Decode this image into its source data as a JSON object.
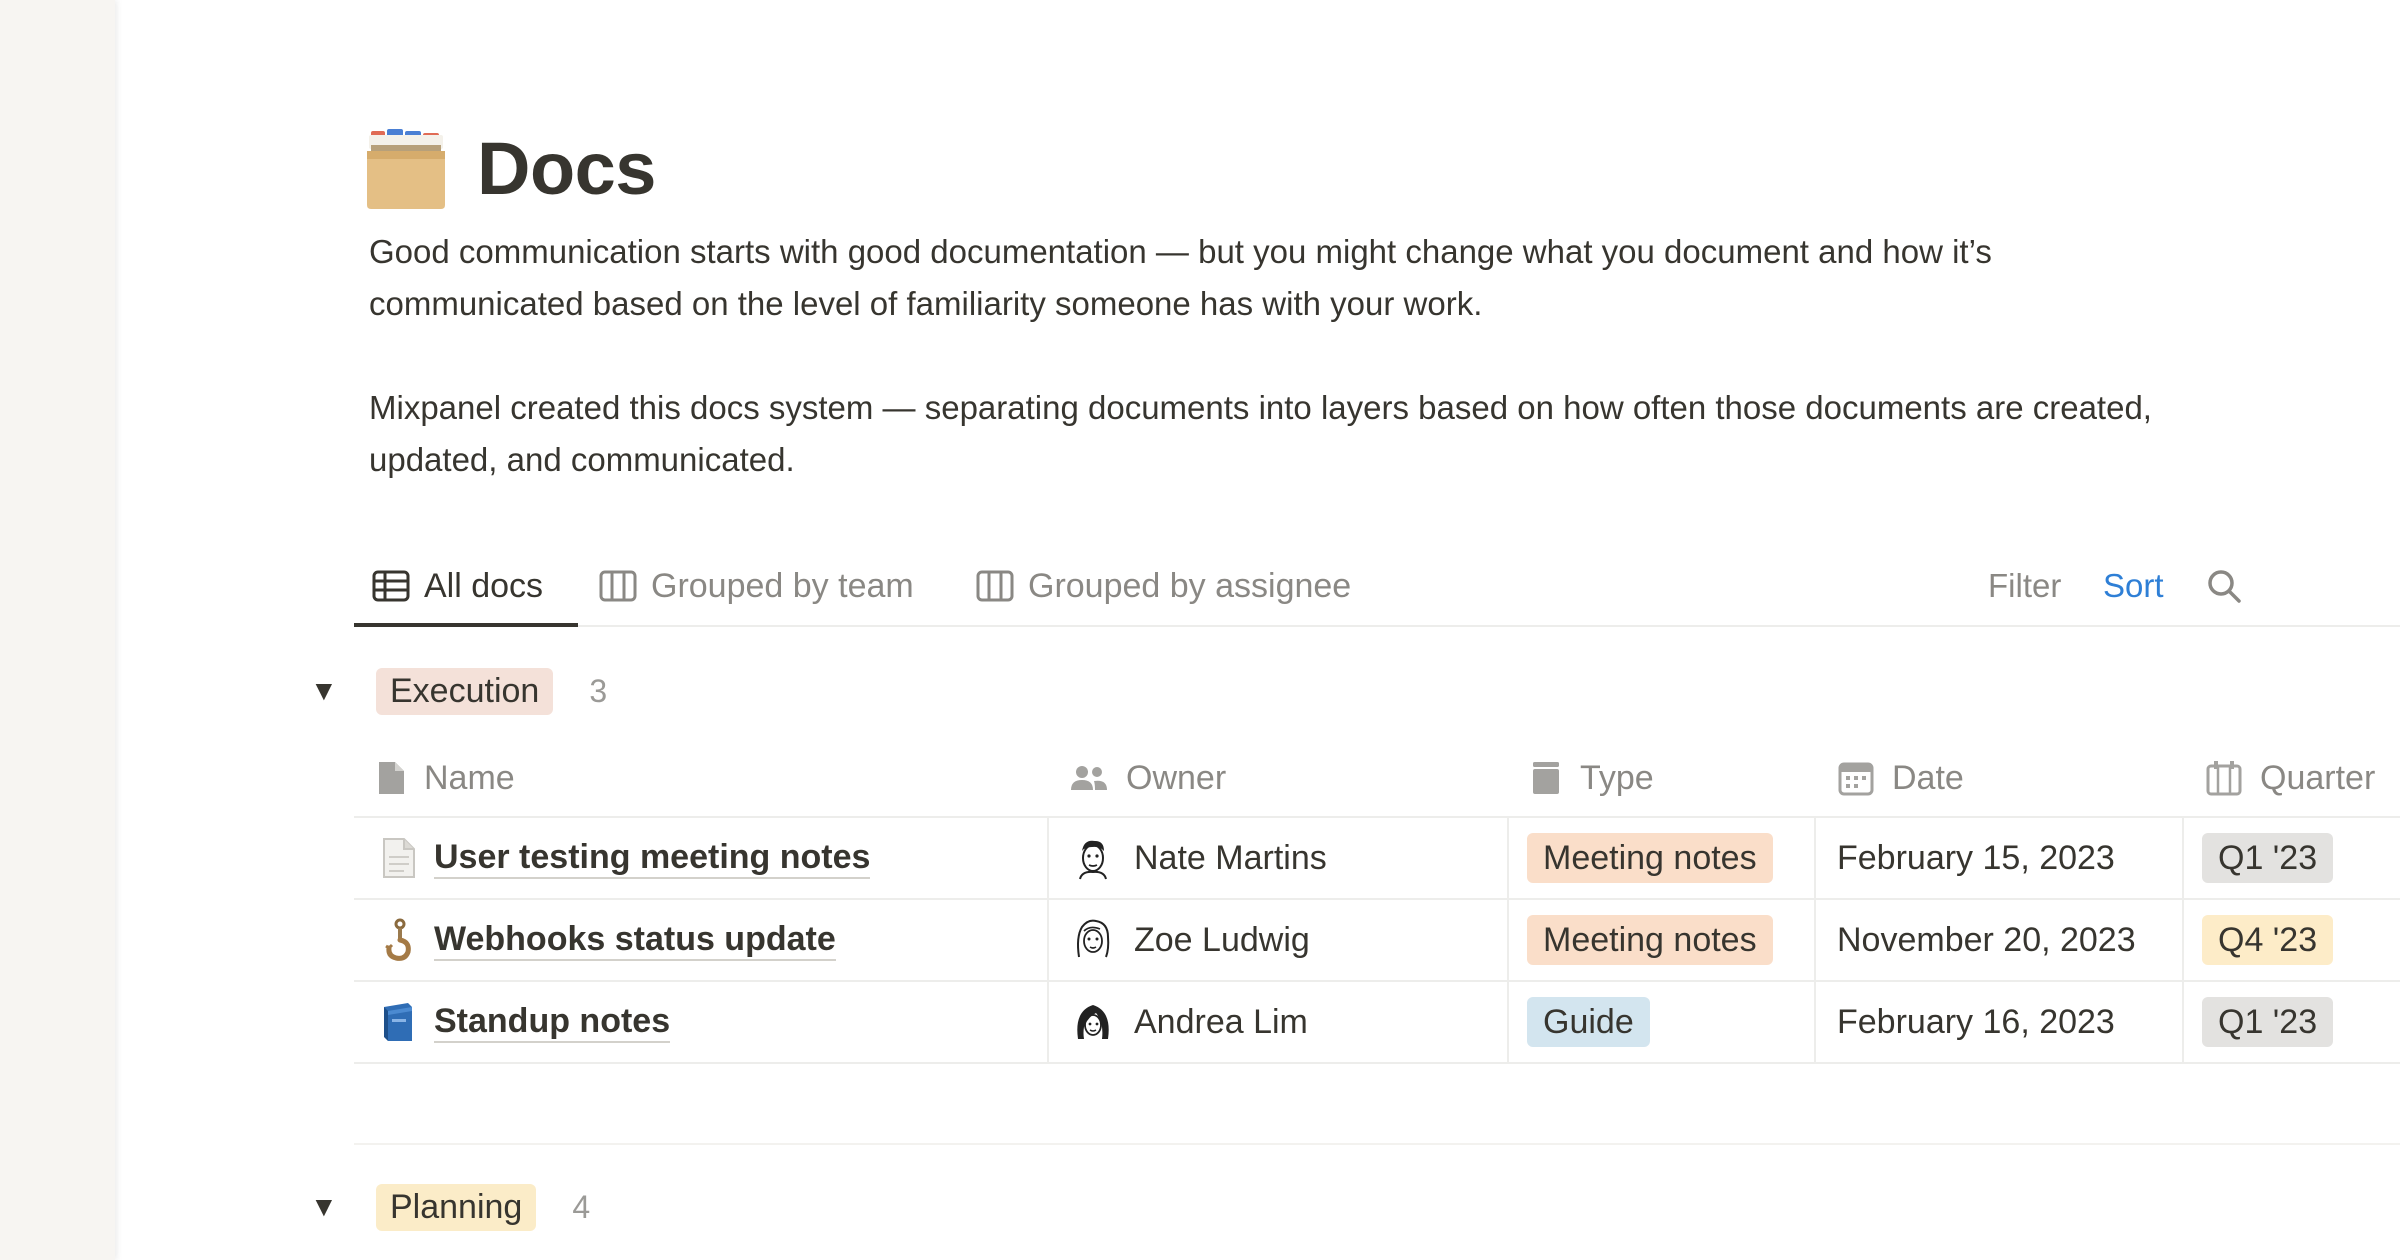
{
  "page": {
    "icon": "card-index-dividers-icon",
    "title": "Docs",
    "description": [
      "Good communication starts with good documentation — but you might change what you document and how it’s communicated based on the level of familiarity someone has with your work.",
      "Mixpanel created this docs system — separating documents into layers based on how often those documents are created, updated, and communicated."
    ]
  },
  "views": {
    "tabs": [
      {
        "label": "All docs",
        "icon": "table-icon",
        "active": true
      },
      {
        "label": "Grouped by team",
        "icon": "board-icon",
        "active": false
      },
      {
        "label": "Grouped by assignee",
        "icon": "board-icon",
        "active": false
      }
    ],
    "filter_label": "Filter",
    "sort_label": "Sort",
    "search_icon": "search-icon"
  },
  "columns": [
    {
      "label": "Name",
      "icon": "document-icon"
    },
    {
      "label": "Owner",
      "icon": "people-icon"
    },
    {
      "label": "Type",
      "icon": "select-icon"
    },
    {
      "label": "Date",
      "icon": "calendar-icon"
    },
    {
      "label": "Quarter",
      "icon": "calendar-grid-icon"
    }
  ],
  "groups": [
    {
      "name": "Execution",
      "count": "3",
      "color": "#f4e1d9",
      "rows": [
        {
          "icon": "page-icon",
          "name": "User testing meeting notes",
          "owner": "Nate Martins",
          "type": "Meeting notes",
          "type_color": "#fadec9",
          "date": "February 15, 2023",
          "quarter": "Q1 '23",
          "quarter_color": "#e3e2e0"
        },
        {
          "icon": "hook-icon",
          "name": "Webhooks status update",
          "owner": "Zoe Ludwig",
          "type": "Meeting notes",
          "type_color": "#fadec9",
          "date": "November 20, 2023",
          "quarter": "Q4 '23",
          "quarter_color": "#fdecc8"
        },
        {
          "icon": "blue-book-icon",
          "name": "Standup notes",
          "owner": "Andrea Lim",
          "type": "Guide",
          "type_color": "#d3e5ef",
          "date": "February 16, 2023",
          "quarter": "Q1 '23",
          "quarter_color": "#e3e2e0"
        }
      ]
    },
    {
      "name": "Planning",
      "count": "4",
      "color": "#fbecc8"
    }
  ]
}
